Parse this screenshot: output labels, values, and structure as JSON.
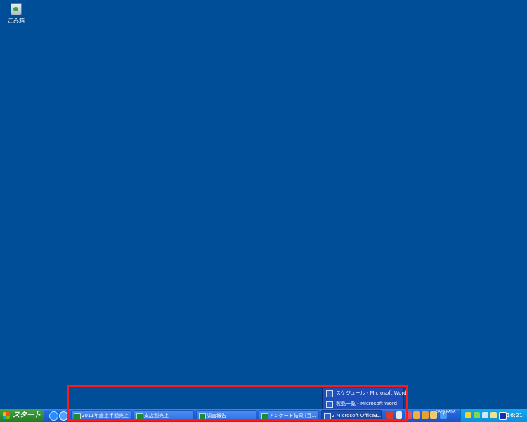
{
  "desktop": {
    "icons": [
      {
        "label": "ごみ箱",
        "icon": "recycle-bin-icon"
      }
    ]
  },
  "taskbar": {
    "start_label": "スタート",
    "tasks": [
      {
        "label": "2011年度上半期売上",
        "icon": "excel-icon"
      },
      {
        "label": "支店別売上",
        "icon": "excel-icon"
      },
      {
        "label": "調査報告",
        "icon": "excel-icon"
      },
      {
        "label": "アンケート結果 [互...",
        "icon": "excel-icon"
      },
      {
        "label": "2 Microsoft Office ...",
        "icon": "word-icon"
      }
    ],
    "group_popup": [
      {
        "label": "スケジュール - Microsoft Word",
        "icon": "word-icon"
      },
      {
        "label": "製品一覧 - Microsoft Word",
        "icon": "word-icon"
      }
    ],
    "ime_text": "CAPS KANA",
    "clock": "16:21"
  },
  "colors": {
    "desktop": "#004e98",
    "taskbar": "#2468e0",
    "start": "#2f8a30",
    "highlight": "#ff1a1a"
  }
}
